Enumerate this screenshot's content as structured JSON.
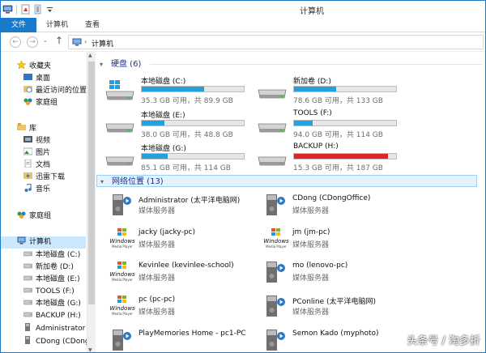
{
  "window": {
    "title": "计算机"
  },
  "ribbon": {
    "tabs": [
      "文件",
      "计算机",
      "查看"
    ]
  },
  "address": {
    "path": "计算机",
    "separator": "›"
  },
  "nav": {
    "items": [
      {
        "label": "收藏夹",
        "icon": "star-icon"
      },
      {
        "label": "桌面",
        "icon": "desktop-icon"
      },
      {
        "label": "最近访问的位置",
        "icon": "recent-places-icon"
      },
      {
        "label": "家庭组",
        "icon": "homegroup-icon"
      },
      {
        "label": "库",
        "icon": "libraries-icon"
      },
      {
        "label": "视频",
        "icon": "video-icon"
      },
      {
        "label": "图片",
        "icon": "pictures-icon"
      },
      {
        "label": "文档",
        "icon": "documents-icon"
      },
      {
        "label": "迅雷下载",
        "icon": "thunder-download-icon"
      },
      {
        "label": "音乐",
        "icon": "music-icon"
      },
      {
        "label": "家庭组",
        "icon": "homegroup-icon"
      },
      {
        "label": "计算机",
        "icon": "computer-icon"
      },
      {
        "label": "本地磁盘 (C:)",
        "icon": "drive-icon"
      },
      {
        "label": "新加卷 (D:)",
        "icon": "drive-icon"
      },
      {
        "label": "本地磁盘 (E:)",
        "icon": "drive-icon"
      },
      {
        "label": "TOOLS (F:)",
        "icon": "drive-icon"
      },
      {
        "label": "本地磁盘 (G:)",
        "icon": "drive-icon"
      },
      {
        "label": "BACKUP (H:)",
        "icon": "drive-icon"
      },
      {
        "label": "Administrator",
        "icon": "network-computer-icon"
      },
      {
        "label": "CDong (CDong",
        "icon": "network-computer-icon"
      }
    ]
  },
  "groups": {
    "drives_header": "硬盘 (6)",
    "network_header": "网络位置 (13)"
  },
  "drives": [
    {
      "name": "本地磁盘 (C:)",
      "size": "35.3 GB 可用，共 89.9 GB",
      "used_fraction": 0.61,
      "color": "#26a0da",
      "windows_logo": true
    },
    {
      "name": "新加卷 (D:)",
      "size": "78.6 GB 可用，共 133 GB",
      "used_fraction": 0.41,
      "color": "#26a0da",
      "windows_logo": false
    },
    {
      "name": "本地磁盘 (E:)",
      "size": "38.0 GB 可用，共 48.8 GB",
      "used_fraction": 0.22,
      "color": "#26a0da",
      "windows_logo": false
    },
    {
      "name": "TOOLS (F:)",
      "size": "94.0 GB 可用，共 114 GB",
      "used_fraction": 0.18,
      "color": "#26a0da",
      "windows_logo": false
    },
    {
      "name": "本地磁盘 (G:)",
      "size": "85.1 GB 可用，共 114 GB",
      "used_fraction": 0.25,
      "color": "#26a0da",
      "windows_logo": false
    },
    {
      "name": "BACKUP (H:)",
      "size": "15.3 GB 可用，共 187 GB",
      "used_fraction": 0.92,
      "color": "#da2626",
      "windows_logo": false
    }
  ],
  "network": [
    {
      "name": "Administrator (太平洋电脑网)",
      "type": "媒体服务器",
      "icon": "media-server-icon"
    },
    {
      "name": "CDong (CDongOffice)",
      "type": "媒体服务器",
      "icon": "media-server-icon"
    },
    {
      "name": "jacky (jacky-pc)",
      "type": "媒体服务器",
      "icon": "windows-media-player-icon"
    },
    {
      "name": "jm (jm-pc)",
      "type": "媒体服务器",
      "icon": "windows-media-player-icon"
    },
    {
      "name": "Kevinlee (kevinlee-school)",
      "type": "媒体服务器",
      "icon": "windows-media-player-icon"
    },
    {
      "name": "mo (lenovo-pc)",
      "type": "媒体服务器",
      "icon": "media-server-icon"
    },
    {
      "name": "pc (pc-pc)",
      "type": "媒体服务器",
      "icon": "windows-media-player-icon"
    },
    {
      "name": "PConline (太平洋电脑网)",
      "type": "媒体服务器",
      "icon": "media-server-icon"
    },
    {
      "name": "PlayMemories Home - pc1-PC",
      "type": "",
      "icon": "media-server-icon"
    },
    {
      "name": "Semon Kado (myphoto)",
      "type": "",
      "icon": "media-server-icon"
    }
  ],
  "wmp_logo_text": "Windows",
  "wmp_logo_sub": "Media Player",
  "watermark": "头条号 / 淘多折"
}
